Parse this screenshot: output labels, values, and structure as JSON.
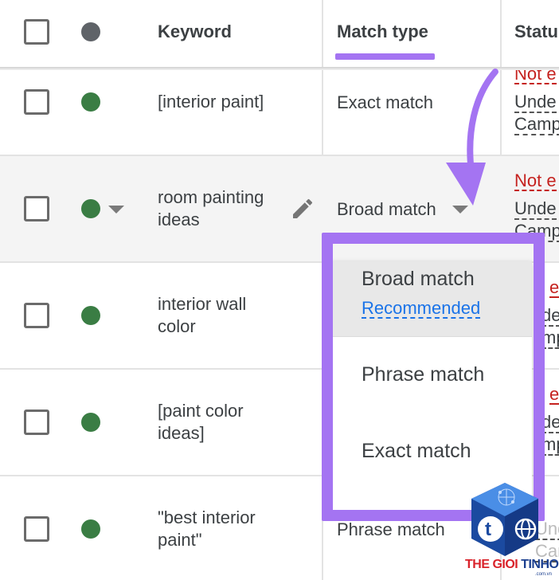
{
  "header": {
    "keyword": "Keyword",
    "match_type": "Match type",
    "status": "Statu"
  },
  "rows": [
    {
      "keyword_line1": "[interior paint]",
      "keyword_line2": "",
      "match_type": "Exact match",
      "status_red": "Not e",
      "status_line1": "Unde",
      "status_line2": "Camp"
    },
    {
      "keyword_line1": "room painting",
      "keyword_line2": "ideas",
      "match_type": "Broad match",
      "status_red": "Not e",
      "status_line1": "Unde",
      "status_line2": "Camp"
    },
    {
      "keyword_line1": "interior wall",
      "keyword_line2": "color",
      "match_type": "",
      "status_red": "e",
      "status_line1": "de",
      "status_line2": "mp"
    },
    {
      "keyword_line1": "[paint color",
      "keyword_line2": "ideas]",
      "match_type": "",
      "status_red": "e",
      "status_line1": "de",
      "status_line2": "mp"
    },
    {
      "keyword_line1": "\"best interior",
      "keyword_line2": "paint\"",
      "match_type": "Phrase match",
      "status_red": "",
      "status_line1": "Unde",
      "status_line2": "Camp"
    }
  ],
  "dropdown": {
    "options": [
      {
        "label": "Broad match",
        "note": "Recommended"
      },
      {
        "label": "Phrase match",
        "note": ""
      },
      {
        "label": "Exact match",
        "note": ""
      }
    ]
  },
  "watermark": {
    "text_red": "THE GIOI",
    "text_blue": "TINHOC",
    "url": ".com.vn"
  },
  "icons": {
    "header_dot": "status-dot-icon",
    "row_dot": "enabled-dot-icon",
    "edit": "pencil-icon",
    "dropdown": "caret-down-icon",
    "annotation_arrow": "curved-arrow-icon"
  },
  "colors": {
    "accent_purple": "#a474f2",
    "status_green": "#3a7d44",
    "header_dot": "#5f6368",
    "link_blue": "#1a73e8",
    "error_red": "#c5221f"
  }
}
